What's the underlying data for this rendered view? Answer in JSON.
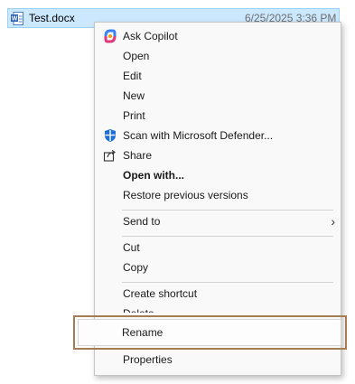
{
  "file": {
    "name": "Test.docx",
    "date": "6/25/2025 3:36 PM",
    "icon": "word-document-icon"
  },
  "menu": {
    "items": [
      {
        "label": "Ask Copilot",
        "icon": "copilot-icon"
      },
      {
        "label": "Open"
      },
      {
        "label": "Edit"
      },
      {
        "label": "New"
      },
      {
        "label": "Print"
      },
      {
        "label": "Scan with Microsoft Defender...",
        "icon": "defender-icon"
      },
      {
        "label": "Share",
        "icon": "share-icon"
      },
      {
        "label": "Open with..."
      },
      {
        "label": "Restore previous versions"
      },
      {
        "label": "Send to"
      },
      {
        "label": "Cut"
      },
      {
        "label": "Copy"
      },
      {
        "label": "Create shortcut"
      },
      {
        "label": "Delete"
      },
      {
        "label": "Rename"
      },
      {
        "label": "Properties"
      }
    ],
    "submenu_arrow": "›"
  },
  "colors": {
    "selection": "#cce8ff",
    "highlight_border": "#a67c52"
  }
}
